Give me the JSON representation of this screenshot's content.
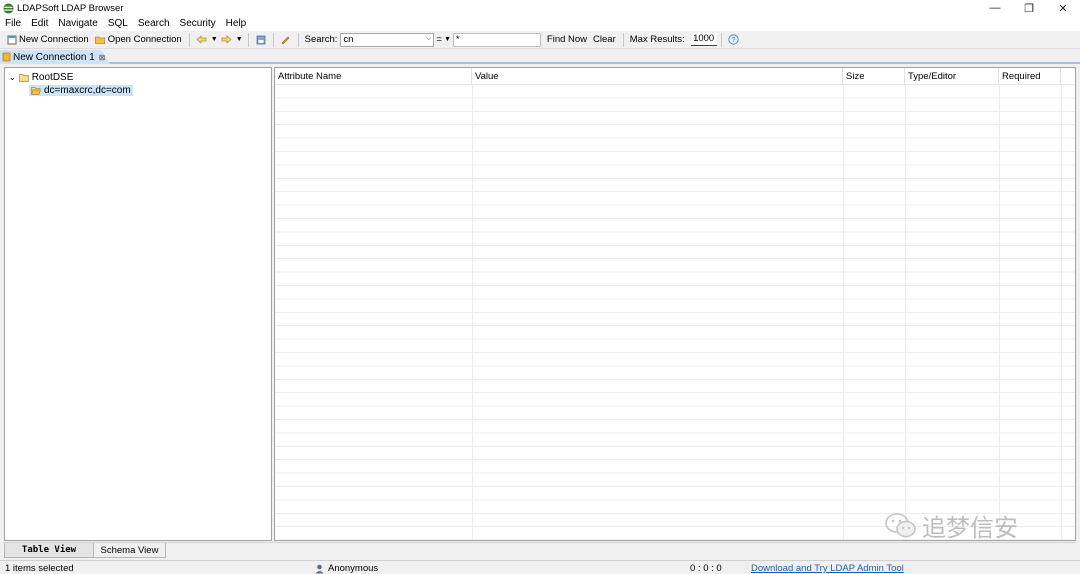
{
  "window": {
    "title": "LDAPSoft LDAP Browser",
    "controls": {
      "minimize": "—",
      "restore": "❐",
      "close": "✕"
    }
  },
  "menu": [
    "File",
    "Edit",
    "Navigate",
    "SQL",
    "Search",
    "Security",
    "Help"
  ],
  "toolbar": {
    "new_connection": "New Connection",
    "open_connection": "Open Connection",
    "search_label": "Search:",
    "search_attribute": "cn",
    "operator": "=",
    "search_value": "*",
    "find_now": "Find Now",
    "clear": "Clear",
    "max_results_label": "Max Results:",
    "max_results_value": "1000"
  },
  "tab": {
    "label": "New Connection 1",
    "close": "⊠"
  },
  "tree": {
    "root": "RootDSE",
    "child": "dc=maxcrc,dc=com"
  },
  "grid": {
    "columns": [
      "Attribute Name",
      "Value",
      "Size",
      "Type/Editor",
      "Required"
    ]
  },
  "bottom_tabs": [
    "Table View",
    "Schema View"
  ],
  "status": {
    "selection": "1 items selected",
    "auth": "Anonymous",
    "position": "0 : 0 : 0",
    "link": "Download and Try LDAP Admin Tool"
  },
  "watermark": "追梦信安",
  "colors": {
    "selection": "#cce4f7",
    "tab_active": "#cfe3f7",
    "link": "#1a5fb4"
  }
}
